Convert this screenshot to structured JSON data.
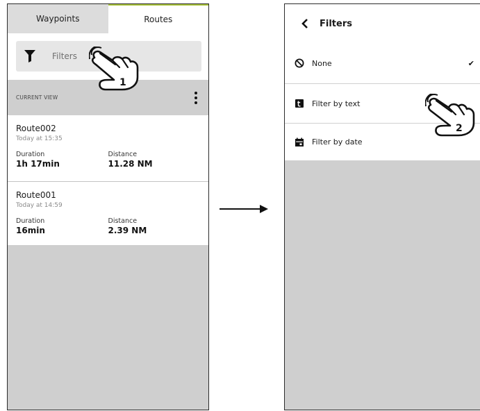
{
  "left": {
    "tabs": [
      {
        "label": "Waypoints",
        "active": false
      },
      {
        "label": "Routes",
        "active": true
      }
    ],
    "filter_bar": {
      "label": "Filters",
      "icon": "funnel-icon"
    },
    "section": {
      "title": "CURRENT VIEW",
      "menu_icon": "kebab-menu-icon"
    },
    "routes": [
      {
        "name": "Route002",
        "time": "Today at 15:35",
        "duration_label": "Duration",
        "duration": "1h 17min",
        "distance_label": "Distance",
        "distance": "11.28 NM"
      },
      {
        "name": "Route001",
        "time": "Today at 14:59",
        "duration_label": "Duration",
        "duration": "16min",
        "distance_label": "Distance",
        "distance": "2.39 NM"
      }
    ]
  },
  "right": {
    "header": {
      "title": "Filters",
      "back_icon": "chevron-left-icon"
    },
    "options": [
      {
        "label": "None",
        "icon": "block-icon",
        "selected": true,
        "check": "✔"
      },
      {
        "label": "Filter by text",
        "icon": "text-icon",
        "selected": false
      },
      {
        "label": "Filter by date",
        "icon": "calendar-icon",
        "selected": false
      }
    ]
  },
  "annotations": {
    "step1": "1",
    "step2": "2"
  },
  "colors": {
    "accent": "#a9c33a",
    "panel_bg": "#cfcfcf",
    "tab_inactive": "#dcdcdc",
    "filter_bar_bg": "#e6e6e6"
  }
}
